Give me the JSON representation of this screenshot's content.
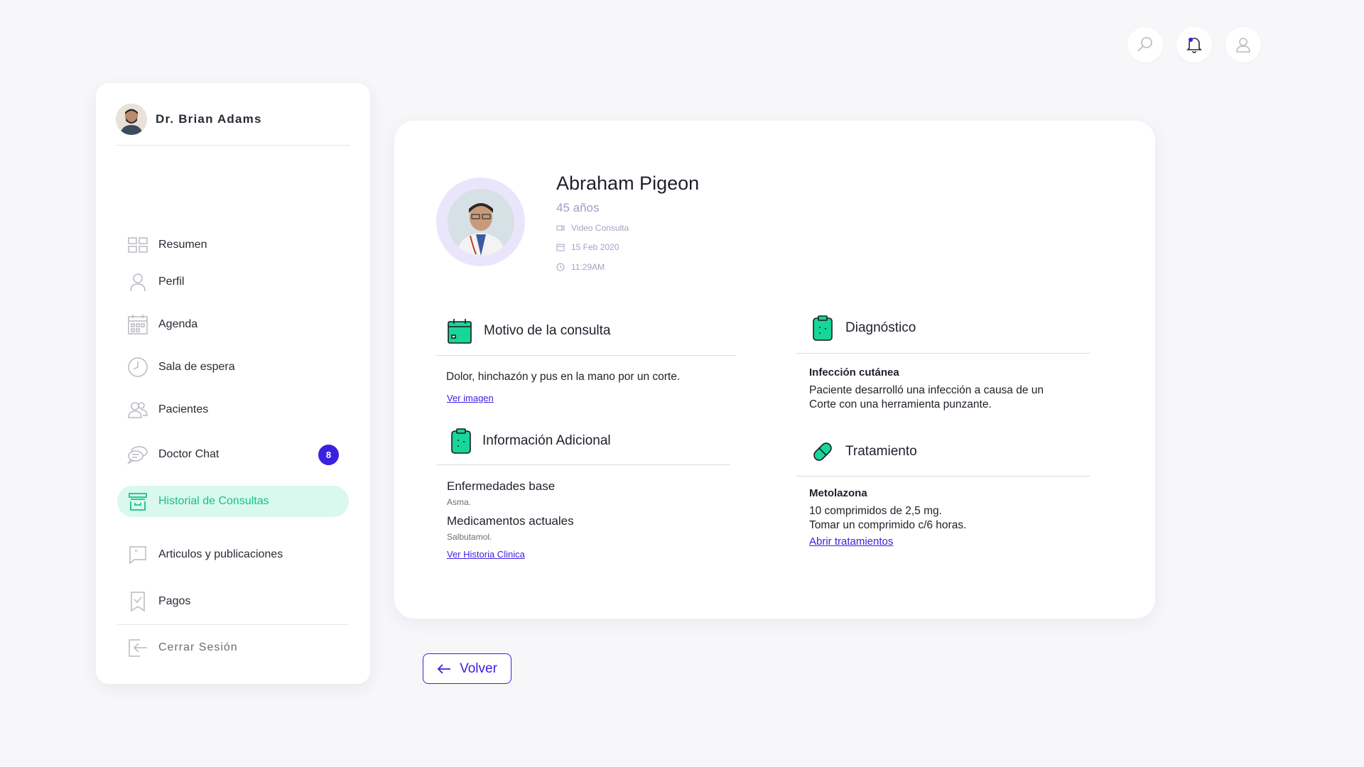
{
  "header": {
    "icons": [
      "search-icon",
      "bell-icon",
      "user-icon"
    ],
    "notification_dot_color": "#3b21e0"
  },
  "sidebar": {
    "doctor_name": "Dr. Brian Adams",
    "items": [
      {
        "label": "Resumen",
        "icon": "dashboard-icon"
      },
      {
        "label": "Perfil",
        "icon": "user-icon"
      },
      {
        "label": "Agenda",
        "icon": "calendar-icon"
      },
      {
        "label": "Sala de espera",
        "icon": "clock-icon"
      },
      {
        "label": "Pacientes",
        "icon": "users-icon"
      },
      {
        "label": "Doctor Chat",
        "icon": "chat-icon",
        "badge": "8"
      },
      {
        "label": "Historial de Consultas",
        "icon": "archive-icon",
        "active": true
      },
      {
        "label": "Articulos y publicaciones",
        "icon": "quote-icon"
      },
      {
        "label": "Pagos",
        "icon": "receipt-icon"
      }
    ],
    "logout_label": "Cerrar Sesión"
  },
  "patient": {
    "name": "Abraham Pigeon",
    "age": "45 años",
    "consult_type": "Video Consulta",
    "date": "15 Feb 2020",
    "time": "11:29AM"
  },
  "motivo": {
    "title": "Motivo de la consulta",
    "text": "Dolor, hinchazón y pus en la mano por un corte.",
    "link": "Ver imagen"
  },
  "info": {
    "title": "Información Adicional",
    "enfermedades_label": "Enfermedades base",
    "enfermedades_value": "Asma.",
    "medicamentos_label": "Medicamentos actuales",
    "medicamentos_value": "Salbutamol.",
    "link": "Ver Historia Clinica"
  },
  "diagnostico": {
    "title": "Diagnóstico",
    "name": "Infección cutánea",
    "line1": "Paciente desarrolló una infección a causa de un",
    "line2": "Corte con una herramienta punzante."
  },
  "tratamiento": {
    "title": "Tratamiento",
    "name": "Metolazona",
    "line1": "10 comprimidos de 2,5 mg.",
    "line2": "Tomar un comprimido c/6 horas.",
    "link": "Abrir tratamientos"
  },
  "back_label": "Volver",
  "colors": {
    "accent": "#3b21e0",
    "green": "#16c28b",
    "active_bg": "#d9f8ee"
  }
}
